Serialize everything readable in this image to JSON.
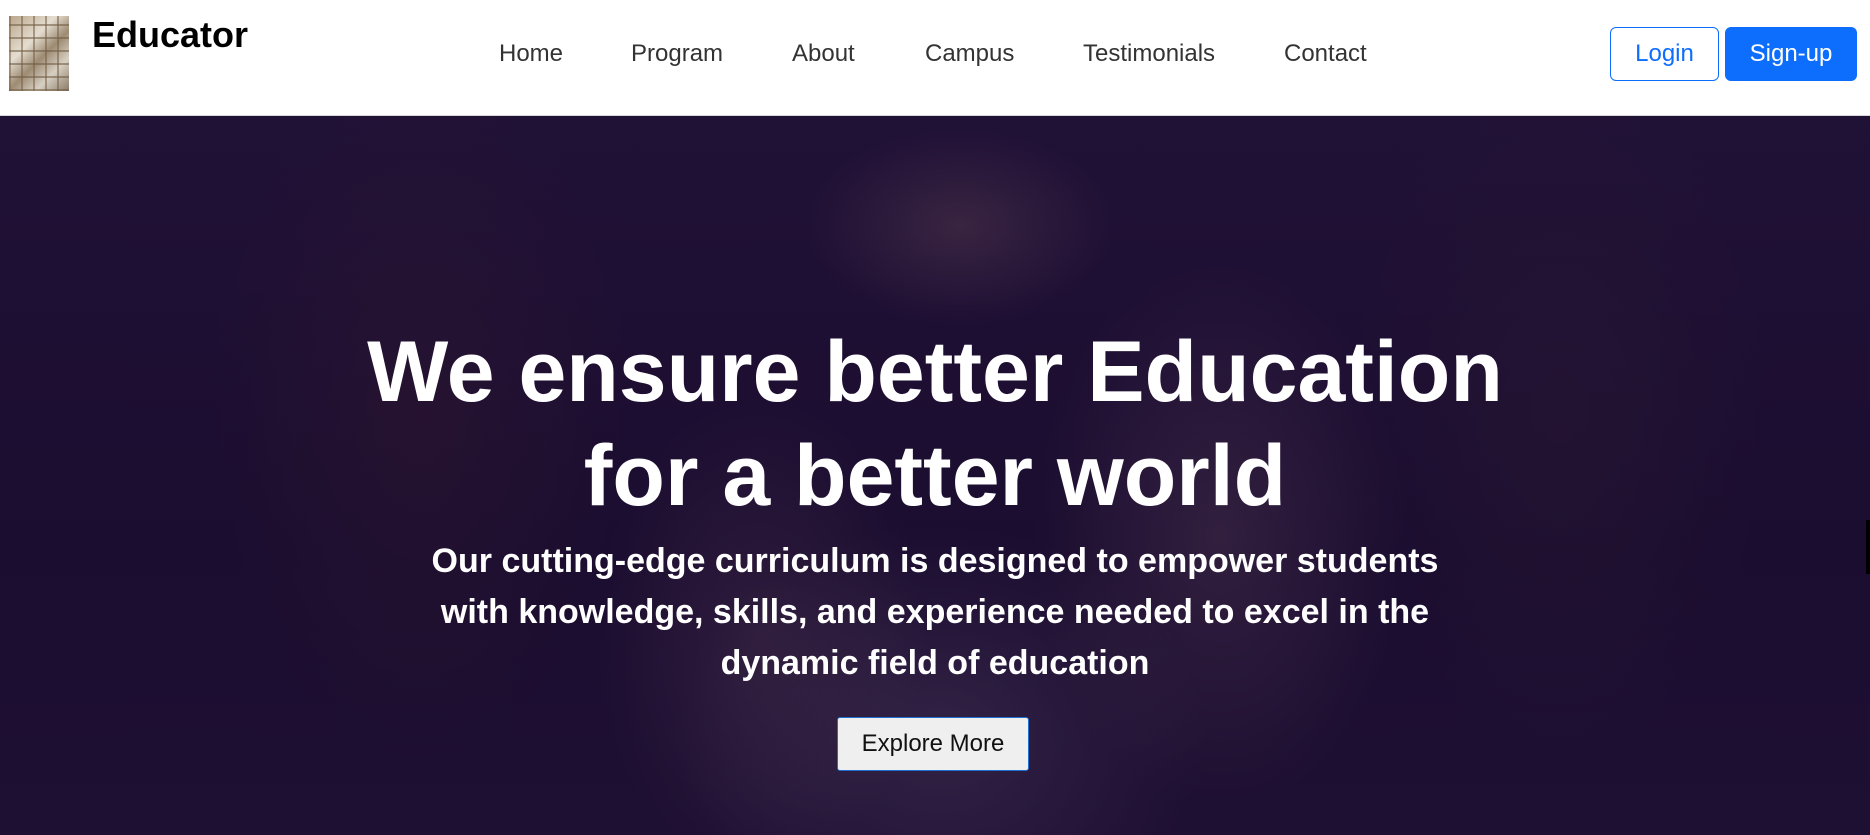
{
  "header": {
    "brand": "Educator",
    "logo_icon": "bookshelf-logo-image",
    "nav": [
      "Home",
      "Program",
      "About",
      "Campus",
      "Testimonials",
      "Contact"
    ],
    "login_label": "Login",
    "signup_label": "Sign-up"
  },
  "hero": {
    "title_line1": "We ensure better Education",
    "title_line2": "for a better world",
    "subtitle": "Our cutting-edge curriculum is designed to empower students with knowledge, skills, and experience needed to excel in the dynamic field of education",
    "cta_label": "Explore More"
  },
  "colors": {
    "accent": "#0d6efd",
    "hero_overlay": "#1d1133",
    "text_light": "#ffffff"
  }
}
